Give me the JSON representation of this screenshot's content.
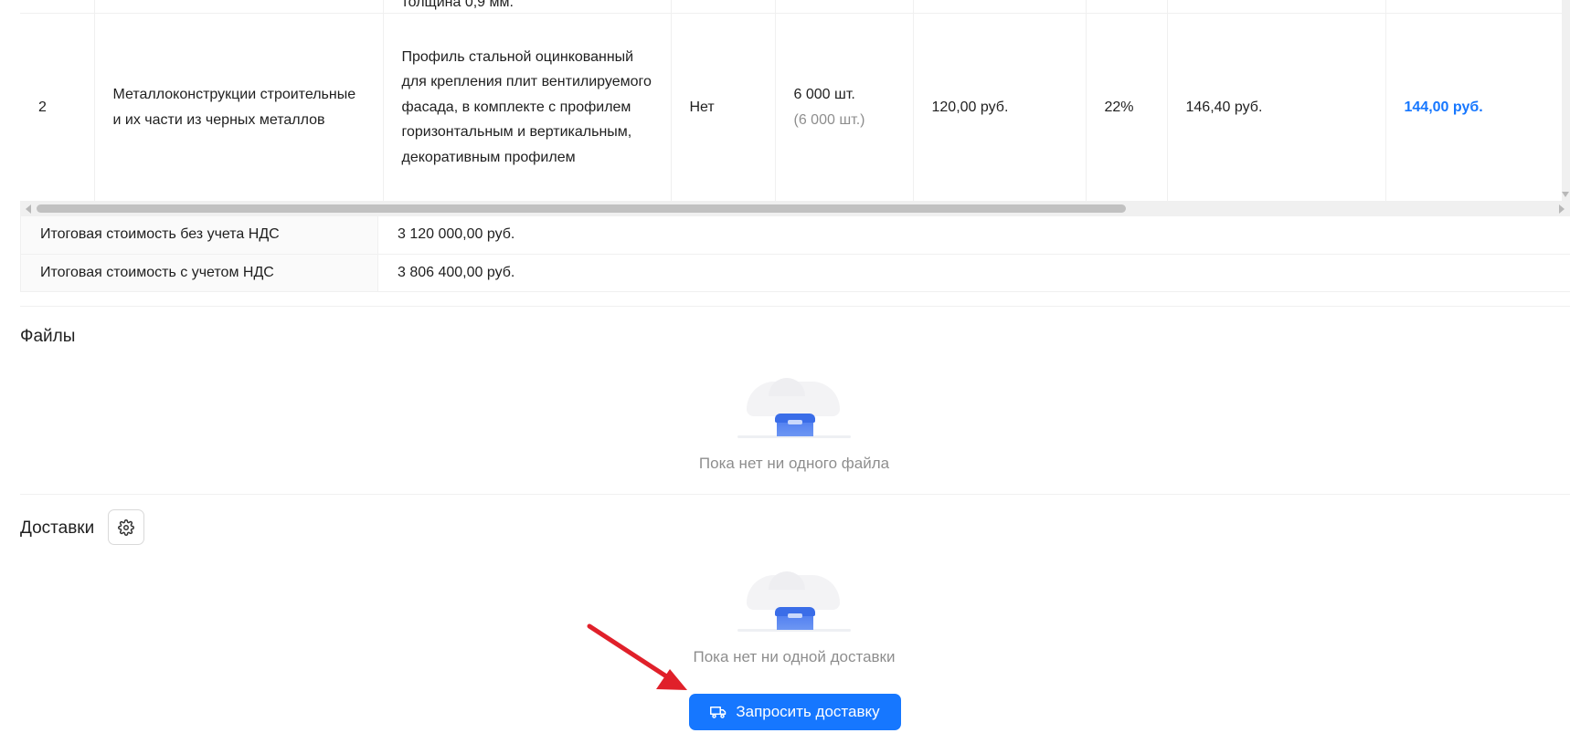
{
  "items_table": {
    "rows": [
      {
        "num": "",
        "name": "",
        "description": "толщина 0,9 мм.",
        "import": "",
        "quantity": "",
        "quantity_sub": "",
        "price": "",
        "vat": "",
        "price_with_vat": "",
        "offer_price": ""
      },
      {
        "num": "2",
        "name": "Металлоконструкции строительные и их части из черных металлов",
        "description": "Профиль стальной оцинкованный для крепления плит вентилируемого фасада, в комплекте с профилем горизонтальным и вертикальным, декоративным профилем",
        "import": "Нет",
        "quantity": "6 000 шт.",
        "quantity_sub": "(6 000 шт.)",
        "price": "120,00 руб.",
        "vat": "22%",
        "price_with_vat": "146,40 руб.",
        "offer_price": "144,00 руб."
      }
    ]
  },
  "totals": [
    {
      "label": "Итоговая стоимость без учета НДС",
      "value": "3 120 000,00 руб."
    },
    {
      "label": "Итоговая стоимость с учетом НДС",
      "value": "3 806 400,00 руб."
    }
  ],
  "files_section": {
    "title": "Файлы",
    "empty_text": "Пока нет ни одного файла"
  },
  "deliveries_section": {
    "title": "Доставки",
    "settings_icon": "gear-icon",
    "empty_text": "Пока нет ни одной доставки",
    "request_button_label": "Запросить доставку",
    "request_button_icon": "truck-icon"
  },
  "colors": {
    "primary": "#1677ff",
    "annotation_arrow": "#e0202a"
  }
}
